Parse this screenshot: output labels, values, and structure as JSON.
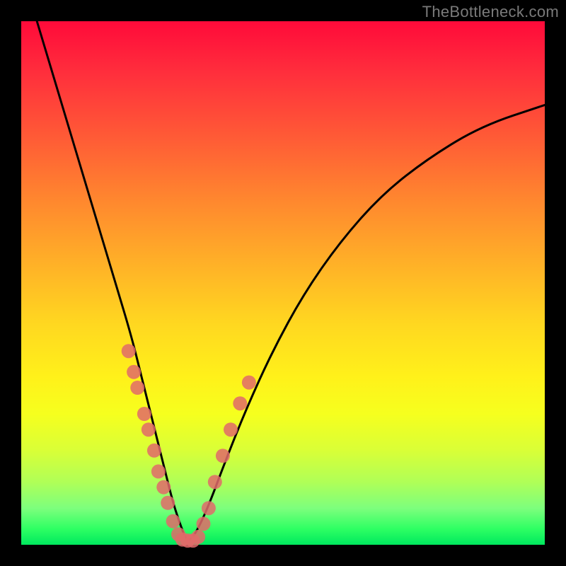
{
  "watermark": "TheBottleneck.com",
  "chart_data": {
    "type": "line",
    "title": "",
    "xlabel": "",
    "ylabel": "",
    "xlim": [
      0,
      100
    ],
    "ylim": [
      0,
      100
    ],
    "grid": false,
    "legend": false,
    "series": [
      {
        "name": "bottleneck-curve",
        "color": "#000000",
        "x": [
          3,
          6,
          9,
          12,
          15,
          18,
          21,
          23,
          24.5,
          26,
          27.5,
          29,
          30.5,
          31.5,
          32.5,
          34,
          36,
          39,
          43,
          48,
          54,
          61,
          69,
          78,
          88,
          100
        ],
        "y": [
          100,
          90,
          80,
          70,
          60,
          50,
          40,
          32,
          26,
          20,
          14,
          8,
          3.5,
          1,
          1,
          3.5,
          8,
          16,
          26,
          37,
          48,
          58,
          67,
          74,
          80,
          84
        ]
      },
      {
        "name": "left-cluster-markers",
        "type": "scatter",
        "color": "#e06a6a",
        "radius": 10,
        "x": [
          20.5,
          21.5,
          22.2,
          23.5,
          24.3,
          25.4,
          26.2,
          27.2,
          28.0,
          29.0,
          30.0
        ],
        "y": [
          37,
          33,
          30,
          25,
          22,
          18,
          14,
          11,
          8,
          4.5,
          2
        ]
      },
      {
        "name": "bottom-cluster-markers",
        "type": "scatter",
        "color": "#e06a6a",
        "radius": 10,
        "x": [
          30.8,
          31.8,
          32.8,
          33.8
        ],
        "y": [
          1,
          0.8,
          0.8,
          1.5
        ]
      },
      {
        "name": "right-cluster-markers",
        "type": "scatter",
        "color": "#e06a6a",
        "radius": 10,
        "x": [
          34.8,
          35.8,
          37.0,
          38.5,
          40.0,
          41.8,
          43.5
        ],
        "y": [
          4,
          7,
          12,
          17,
          22,
          27,
          31
        ]
      }
    ]
  }
}
